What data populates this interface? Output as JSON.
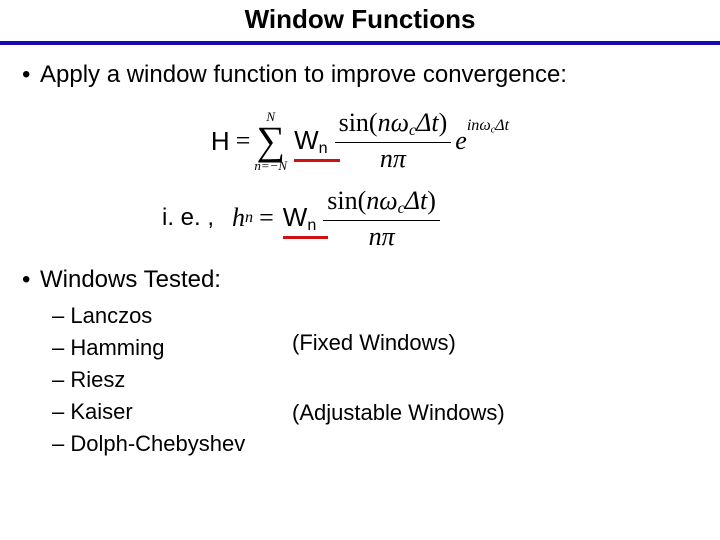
{
  "title": "Window Functions",
  "bullets": {
    "apply": "Apply a window function to improve convergence:",
    "tested": "Windows Tested:"
  },
  "ie_label": "i. e. ,",
  "eq1": {
    "lhs": "H",
    "eq": "=",
    "sum_top": "N",
    "sum_bot": "n=−N",
    "W": "W",
    "W_sub": "n",
    "frac_num_pre": "sin(",
    "frac_num_nω": "nω",
    "frac_num_c": "c",
    "frac_num_Δt": "Δt",
    "frac_num_post": ")",
    "frac_den_nπ": "nπ",
    "e": "e",
    "exp_inω": "inω",
    "exp_c": "c",
    "exp_Δt": "Δt"
  },
  "eq2": {
    "lhs_h": "h",
    "lhs_n": "n",
    "eq": "=",
    "W": "W",
    "W_sub": "n",
    "frac_num_pre": "sin(",
    "frac_num_nω": "nω",
    "frac_num_c": "c",
    "frac_num_Δt": "Δt",
    "frac_num_post": ")",
    "frac_den_nπ": "nπ"
  },
  "windows": [
    "Lanczos",
    "Hamming",
    "Riesz",
    "Kaiser",
    "Dolph-Chebyshev"
  ],
  "annotations": {
    "fixed": "(Fixed Windows)",
    "adjustable": "(Adjustable Windows)"
  },
  "dash": "– "
}
